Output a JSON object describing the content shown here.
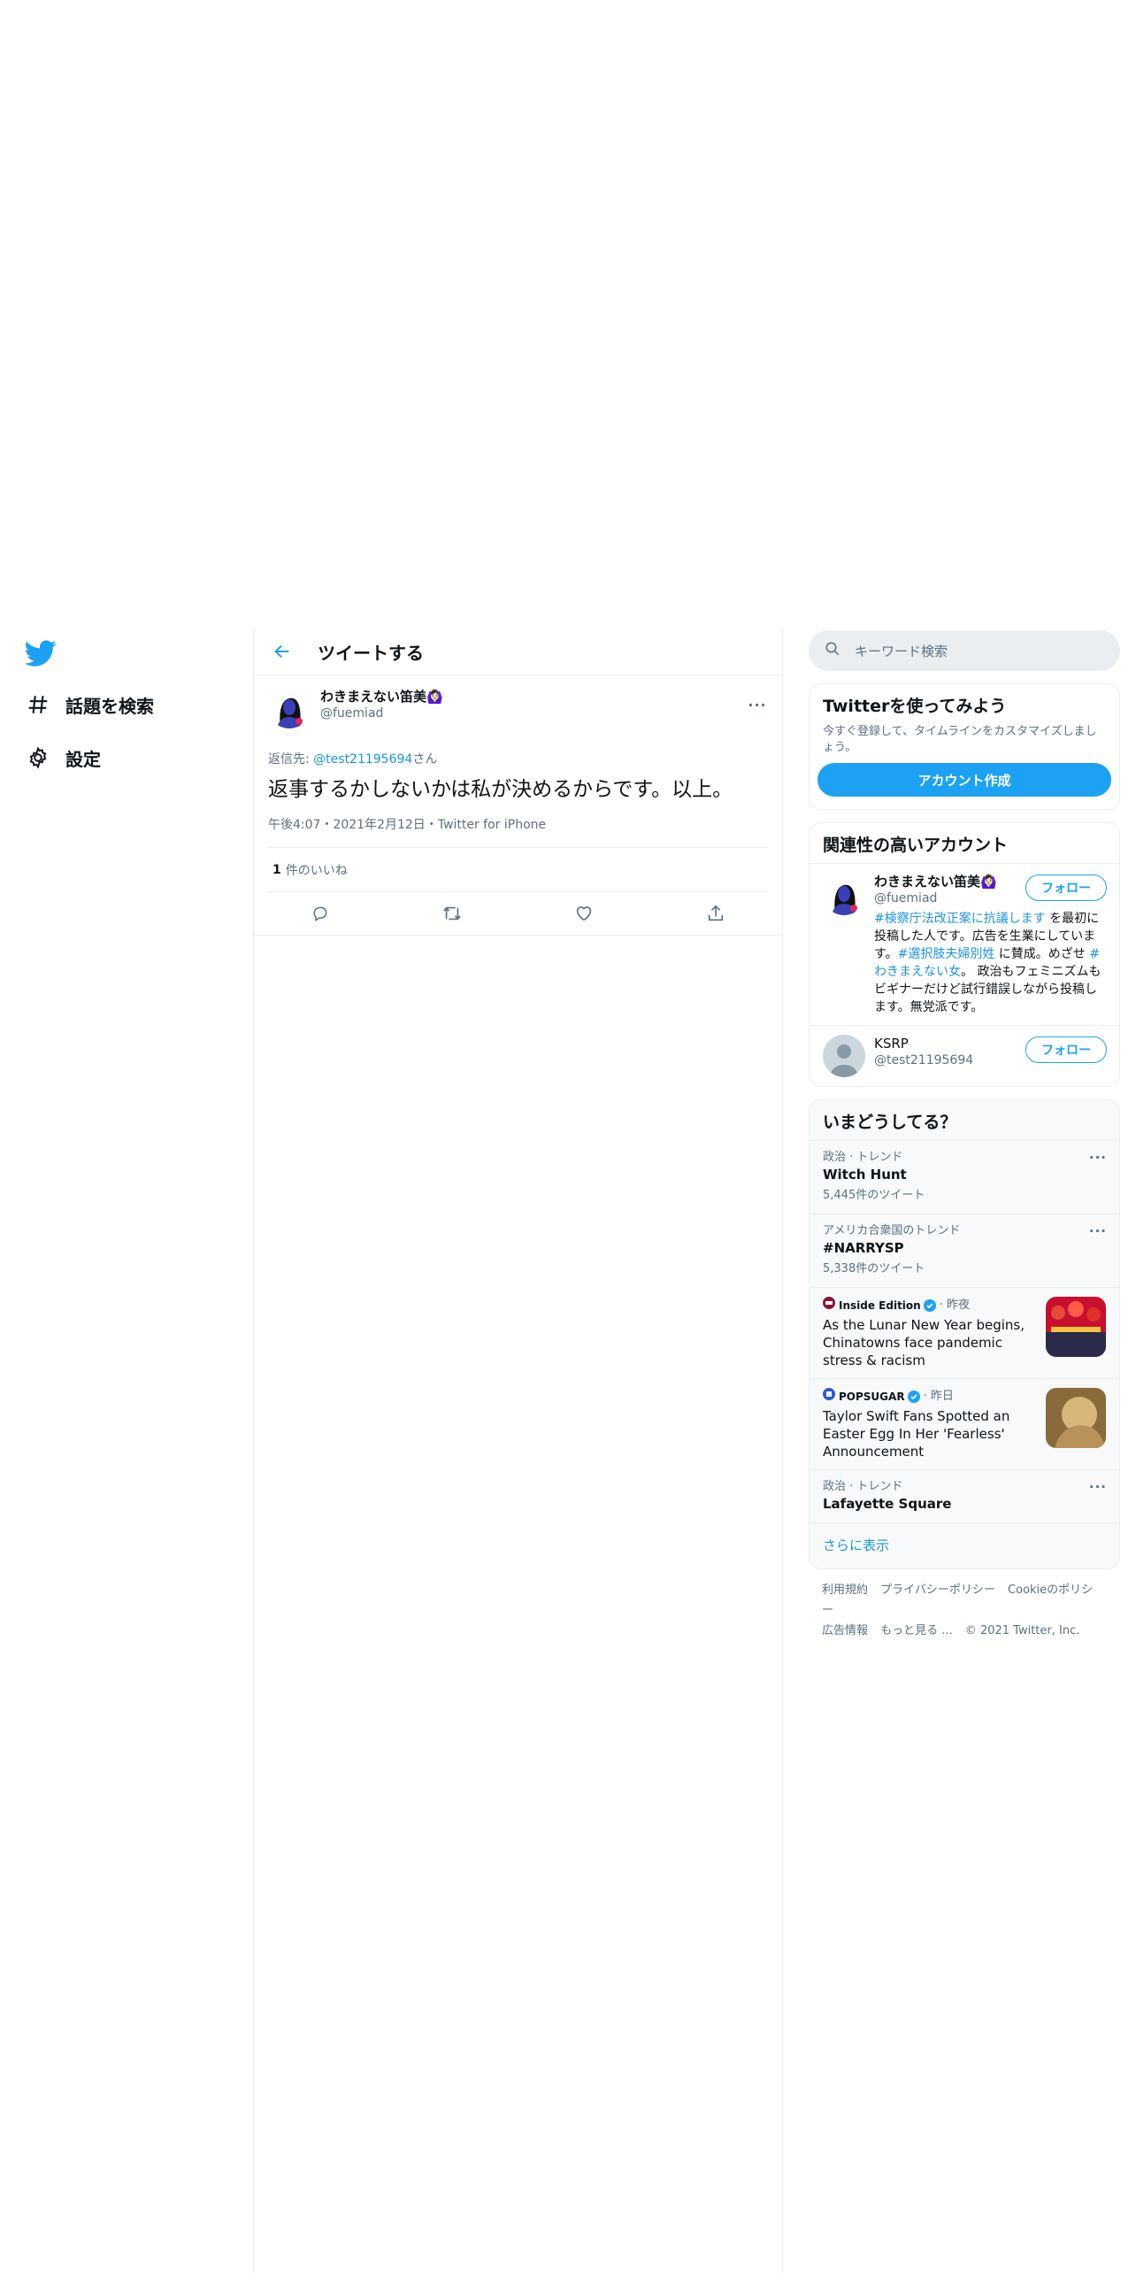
{
  "nav": {
    "explore_label": "話題を検索",
    "settings_label": "設定"
  },
  "header": {
    "title": "ツイートする"
  },
  "tweet": {
    "author_name": "わきまえない笛美🙆🏻‍♀️",
    "author_handle": "@fuemiad",
    "reply_prefix": "返信先: ",
    "reply_mention": "@test21195694",
    "reply_suffix": "さん",
    "text": "返事するかしないかは私が決めるからです。以上。",
    "timestamp": "午後4:07・2021年2月12日・Twitter for iPhone",
    "likes_count": "1",
    "likes_label": "件のいいね",
    "more": "···"
  },
  "search": {
    "placeholder": "キーワード検索"
  },
  "signup": {
    "title": "Twitterを使ってみよう",
    "description": "今すぐ登録して、タイムラインをカスタマイズしましょう。",
    "button": "アカウント作成"
  },
  "related": {
    "title": "関連性の高いアカウント",
    "follow_label": "フォロー",
    "accounts": [
      {
        "name": "わきまえない笛美🙆🏻‍♀️",
        "handle": "@fuemiad",
        "bio_1": "#検察庁法改正案に抗議します",
        "bio_2": " を最初に投稿した人です。広告を生業にしています。",
        "bio_3": "#選択肢夫婦別姓",
        "bio_4": " に賛成。めざせ ",
        "bio_5": "#わきまえない女",
        "bio_6": "。 政治もフェミニズムもビギナーだけど試行錯誤しながら投稿します。無党派です。"
      },
      {
        "name": "KSRP",
        "handle": "@test21195694"
      }
    ]
  },
  "trends": {
    "title": "いまどうしてる？",
    "more": "···",
    "items": [
      {
        "category": "政治 · トレンド",
        "name": "Witch Hunt",
        "count": "5,445件のツイート"
      },
      {
        "category": "アメリカ合衆国のトレンド",
        "name": "#NARRYSP",
        "count": "5,338件のツイート"
      }
    ],
    "news": [
      {
        "source": "Inside Edition",
        "time": "· 昨夜",
        "title": "As the Lunar New Year begins, Chinatowns face pandemic stress & racism"
      },
      {
        "source": "POPSUGAR",
        "time": "· 昨日",
        "title": "Taylor Swift Fans Spotted an Easter Egg In Her 'Fearless' Announcement"
      }
    ],
    "last": {
      "category": "政治 · トレンド",
      "name": "Lafayette Square"
    },
    "show_more": "さらに表示"
  },
  "footer": {
    "terms": "利用規約",
    "privacy": "プライバシーポリシー",
    "cookie": "Cookieのポリシー",
    "ads": "広告情報",
    "more": "もっと見る ...",
    "copyright": "© 2021 Twitter, Inc."
  },
  "colors": {
    "accent": "#1da1f2",
    "link": "#1b95e0",
    "secondary_text": "#5b7083",
    "border": "#ebeef0"
  }
}
